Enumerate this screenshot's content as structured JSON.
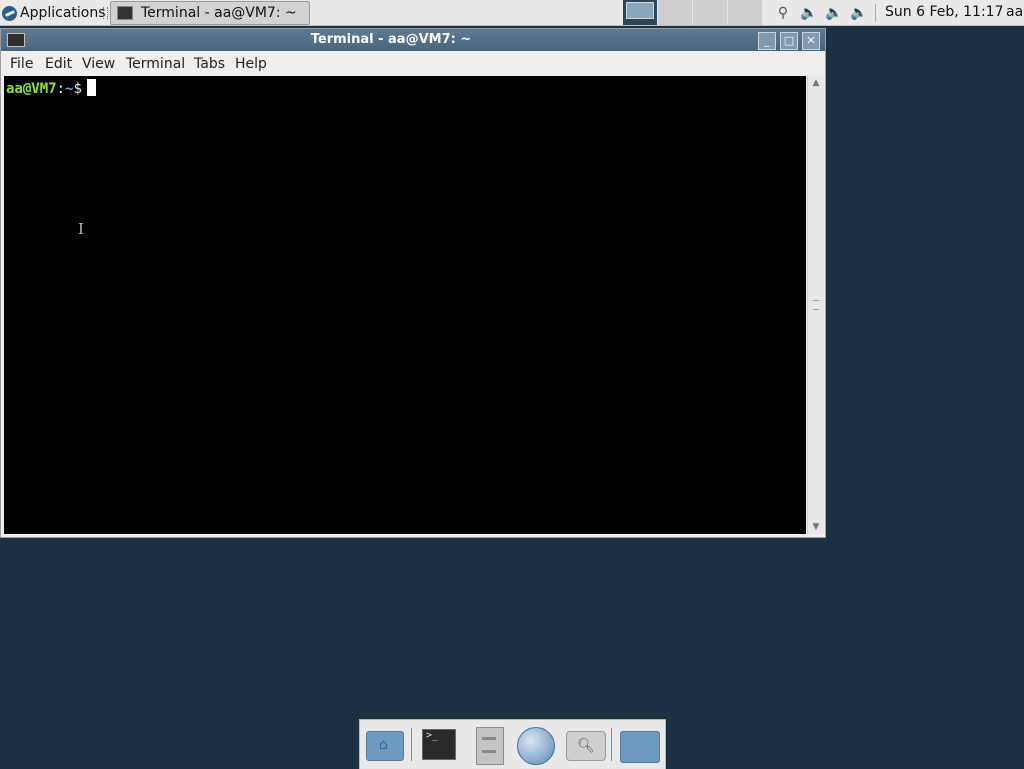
{
  "top_panel": {
    "applications_label": "Applications",
    "task_title": "Terminal - aa@VM7: ~",
    "clock": "Sun  6 Feb, 11:17",
    "user": "aa"
  },
  "window": {
    "title": "Terminal - aa@VM7: ~",
    "menu": [
      "File",
      "Edit",
      "View",
      "Terminal",
      "Tabs",
      "Help"
    ]
  },
  "terminal": {
    "user_host": "aa@VM7",
    "separator": ":",
    "path": "~",
    "dollar": "$"
  },
  "dock": {
    "items": [
      "home-folder",
      "terminal",
      "file-manager",
      "web-browser",
      "app-finder",
      "folder"
    ]
  }
}
